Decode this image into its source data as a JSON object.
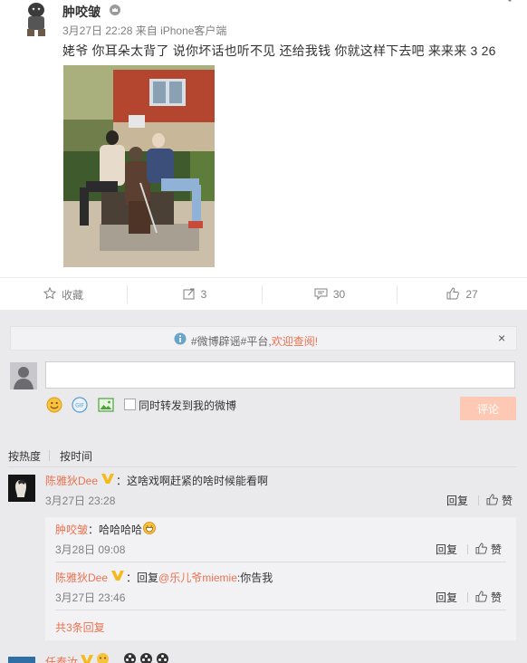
{
  "post": {
    "author": "肿咬皱",
    "time": "3月27日 22:28",
    "source": "来自 iPhone客户端",
    "text": "姥爷 你耳朵太背了 说你坏话也听不见 还给我钱 你就这样下去吧  来来来 3 26"
  },
  "actions": {
    "favorite": "收藏",
    "repost_count": "3",
    "comment_count": "30",
    "like_count": "27"
  },
  "notice": {
    "tag": "#微博辟谣#平台,",
    "link": "欢迎查阅!",
    "close": "×"
  },
  "composer": {
    "forward_label": "同时转发到我的微博",
    "submit_label": "评论"
  },
  "sort": {
    "hot": "按热度",
    "time": "按时间"
  },
  "comments": [
    {
      "author": "陈雅狄Dee",
      "text": "：这啥戏啊赶紧的啥时候能看啊",
      "time": "3月27日 23:28",
      "reply_label": "回复",
      "like_label": "赞",
      "replies": [
        {
          "author": "肿咬皱",
          "text": "：哈哈哈哈",
          "time": "3月28日 09:08",
          "reply_label": "回复",
          "like_label": "赞"
        },
        {
          "author": "陈雅狄Dee",
          "text_prefix": "：回复",
          "mention": "@乐儿爷miemie",
          "text_suffix": ":你告我",
          "time": "3月27日 23:46",
          "reply_label": "回复",
          "like_label": "赞"
        }
      ],
      "total_replies": "共3条回复"
    },
    {
      "author": "任泰汝"
    }
  ],
  "colors": {
    "accent": "#eb7350",
    "comment_bg": "#eaeaec",
    "sub_bg": "#f2f2f5",
    "meta_gray": "#808080",
    "submit_disabled": "#fdc9b5"
  },
  "icons": [
    "star-icon",
    "repost-icon",
    "comment-icon",
    "like-icon",
    "info-icon",
    "emoji-icon",
    "gif-icon",
    "image-icon",
    "vip-icon",
    "chevron-down-icon"
  ]
}
